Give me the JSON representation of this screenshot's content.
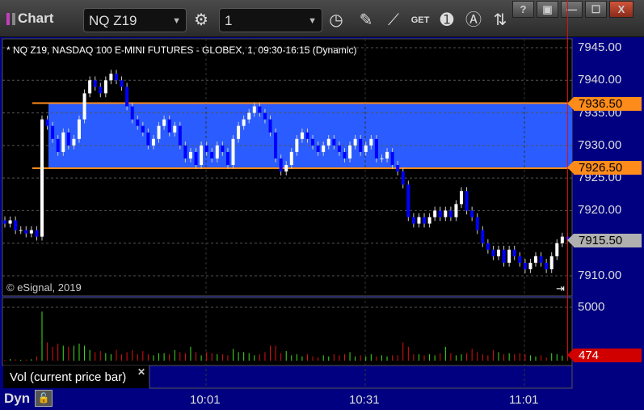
{
  "window": {
    "title": "Chart",
    "buttons": [
      "?",
      "▣",
      "—",
      "☐",
      "X"
    ]
  },
  "toolbar": {
    "symbol": "NQ Z19",
    "interval": "1",
    "icons": [
      "gear-icon",
      "clock-icon",
      "pencil-icon",
      "study-icon",
      "get-icon",
      "play-icon",
      "annotation-icon",
      "sync-icon"
    ]
  },
  "chart": {
    "header": "* NQ Z19, NASDAQ 100 E-MINI FUTURES - GLOBEX, 1, 09:30-16:15 (Dynamic)",
    "copyright": "© eSignal, 2019",
    "price_labels": [
      "7945.00",
      "7940.00",
      "7935.00",
      "7930.00",
      "7925.00",
      "7920.00",
      "7915.00",
      "7910.00"
    ],
    "price_ticks": [
      7945,
      7940,
      7935,
      7930,
      7925,
      7920,
      7915,
      7910
    ],
    "zone": {
      "top": 7936.5,
      "bottom": 7926.5,
      "top_label": "7936.50",
      "bottom_label": "7926.50",
      "fill": "#2a5cff",
      "line": "#ff8c1a"
    },
    "last_price_label": "7915.50",
    "last_price": 7915.5,
    "up_color": "#ffffff",
    "down_color": "#0000ff"
  },
  "chart_data": {
    "type": "candlestick",
    "closes": [
      7918,
      7918.5,
      7917,
      7917,
      7916.5,
      7917,
      7916,
      7934,
      7933,
      7931,
      7929,
      7932,
      7930,
      7931,
      7934,
      7938,
      7940,
      7939,
      7938,
      7940,
      7941,
      7940,
      7939,
      7936,
      7934,
      7933,
      7932,
      7930,
      7931,
      7933,
      7934,
      7932,
      7933,
      7930,
      7928,
      7929,
      7927,
      7930,
      7929,
      7928,
      7930,
      7929,
      7927,
      7931,
      7933,
      7934,
      7935,
      7936,
      7935,
      7934,
      7932,
      7928,
      7926,
      7927,
      7929,
      7931,
      7932,
      7931,
      7930,
      7929,
      7930,
      7931,
      7930,
      7929,
      7928,
      7930,
      7931,
      7929,
      7930,
      7931,
      7928,
      7928,
      7929,
      7927,
      7926,
      7924,
      7919,
      7918,
      7919,
      7918,
      7919,
      7920,
      7919,
      7920,
      7919,
      7921,
      7923,
      7920,
      7919,
      7917,
      7915,
      7914,
      7913,
      7914,
      7912,
      7914,
      7913,
      7912,
      7911,
      7912,
      7913,
      7912,
      7911,
      7913,
      7915,
      7916,
      7915.5
    ],
    "volume": [
      80,
      150,
      120,
      90,
      100,
      130,
      400,
      4600,
      1700,
      1300,
      1600,
      1400,
      1300,
      1400,
      1600,
      1400,
      1000,
      800,
      900,
      700,
      600,
      1000,
      600,
      800,
      1000,
      600,
      900,
      600,
      500,
      700,
      700,
      600,
      1000,
      800,
      700,
      1300,
      800,
      500,
      800,
      700,
      600,
      600,
      500,
      1100,
      800,
      800,
      700,
      500,
      600,
      800,
      1400,
      1400,
      700,
      900,
      500,
      600,
      400,
      600,
      400,
      300,
      500,
      400,
      600,
      500,
      600,
      800,
      400,
      500,
      400,
      600,
      400,
      500,
      400,
      500,
      500,
      1700,
      1300,
      600,
      600,
      500,
      600,
      500,
      700,
      1300,
      700,
      500,
      600,
      700,
      1100,
      800,
      600,
      500,
      1000,
      800,
      600,
      700,
      600,
      700,
      600,
      500,
      400,
      500,
      300,
      700,
      600,
      474
    ],
    "volume_label": "Vol (current price bar)",
    "volume_tick": "5000",
    "volume_last": "474",
    "time_labels": [
      "10:01",
      "10:31",
      "11:01"
    ]
  },
  "footer": {
    "mode": "Dyn"
  }
}
